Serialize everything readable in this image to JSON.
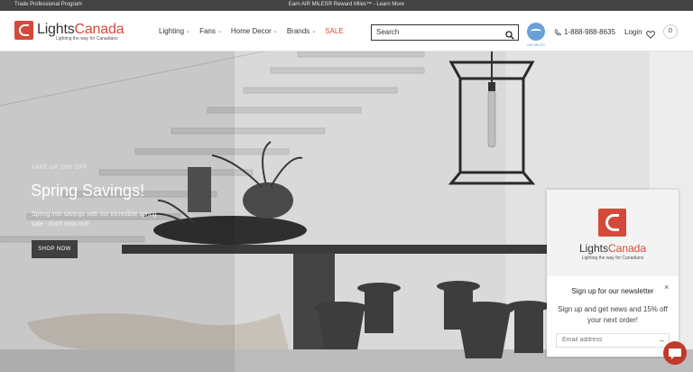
{
  "topbar": {
    "left_text": "Trade Professional Program",
    "center_text": "Earn AIR MILES® Reward Miles™ - Learn More"
  },
  "header": {
    "logo": {
      "part1": "Lights",
      "part2": "Canada",
      "tagline": "Lighting the way for Canadians"
    },
    "nav": [
      {
        "label": "Lighting",
        "chevron": "⌄"
      },
      {
        "label": "Fans",
        "chevron": "⌄"
      },
      {
        "label": "Home Decor",
        "chevron": "⌄"
      },
      {
        "label": "Brands",
        "chevron": "⌄"
      },
      {
        "label": "SALE"
      }
    ],
    "search": {
      "placeholder": "Search"
    },
    "airmiles_label": "AIR MILES",
    "phone": "1-888-988-8635",
    "login": "Login",
    "cart_count": "0"
  },
  "hero": {
    "eyebrow": "SAVE UP 20% OFF",
    "title": "Spring Savings!",
    "text": "Spring into savings with our incredible spring sale - don't miss out!",
    "button": "SHOP NOW"
  },
  "popup": {
    "brand": {
      "part1": "Lights",
      "part2": "Canada",
      "tagline": "Lighting the way for Canadians"
    },
    "close": "×",
    "heading": "Sign up for our newsletter",
    "description": "Sign up and get news and 15% off your next order!",
    "email_placeholder": "Email address",
    "submit_arrow": "→"
  },
  "colors": {
    "brand_red": "#d34a3b",
    "topbar_bg": "#444444",
    "airmiles_blue": "#6aa0d6",
    "button_dark": "#3f3f3f"
  },
  "icons": {
    "search": "search-icon",
    "phone": "phone-icon",
    "heart": "heart-icon",
    "chat": "chat-icon"
  }
}
